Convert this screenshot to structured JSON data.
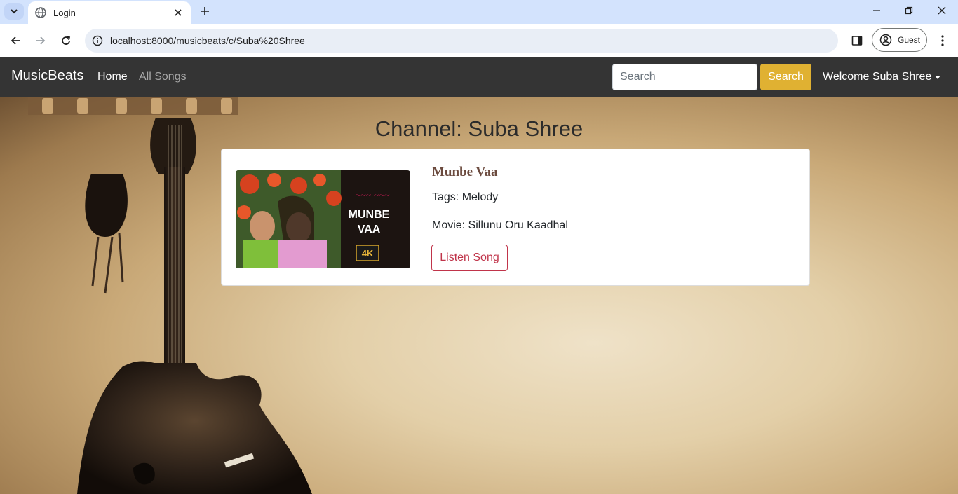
{
  "browser": {
    "tab_title": "Login",
    "url": "localhost:8000/musicbeats/c/Suba%20Shree",
    "profile_label": "Guest"
  },
  "navbar": {
    "brand": "MusicBeats",
    "links": [
      "Home",
      "All Songs"
    ],
    "search_placeholder": "Search",
    "search_button": "Search",
    "user_menu": "Welcome Suba Shree"
  },
  "page": {
    "channel_title": "Channel: Suba Shree",
    "songs": [
      {
        "title": "Munbe Vaa",
        "tags": "Tags: Melody",
        "movie": "Movie: Sillunu Oru Kaadhal",
        "button": "Listen Song",
        "thumbnail_text": [
          "MUNBE",
          "VAA",
          "4K"
        ]
      }
    ]
  },
  "colors": {
    "navbar_bg": "#343434",
    "search_button": "#e0b132",
    "listen_button": "#c0344a",
    "song_title": "#6b4a3e"
  }
}
